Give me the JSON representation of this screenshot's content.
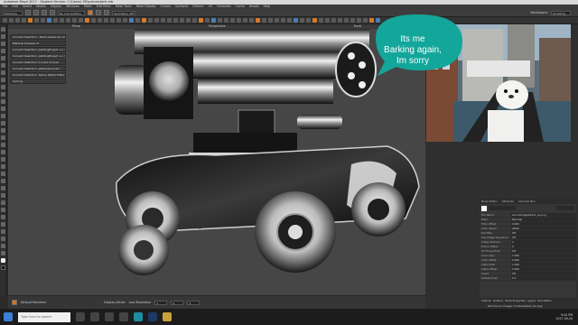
{
  "window": {
    "title": "Autodesk Maya 2017 - Student Version: C:\\Users\\ 3D\\scenes\\tank.mb"
  },
  "menubar": {
    "items": [
      "File",
      "Edit",
      "Select",
      "Modify",
      "Display",
      "Windows",
      "Mesh",
      "Edit Mesh",
      "Mesh Tools",
      "Mesh Display",
      "Curves",
      "Surfaces",
      "Deform",
      "UV",
      "Generate",
      "Cache",
      "Arnold",
      "Help"
    ]
  },
  "toolbar": {
    "mode": "Modeling",
    "live": "No Live Surface",
    "symmetry": "Symmetry: Off",
    "workspace": "Sculpting",
    "labels": [
      "Workspace:",
      "Opacity"
    ]
  },
  "viewport": {
    "header_left": "Persp",
    "header_mid": "Perspective",
    "header_right": "Front"
  },
  "history": {
    "items": [
      "Convert Selection - Mesh (select all edges)",
      "Material Preview: D",
      "Convert Selection -pathingProject +> Orientation: None 1 Mesh",
      "Convert Selection -pathingProject +> Orientation: None",
      "Convert Selection: Curves Convex",
      "Convert Selection: pathingConvert",
      "Convert Selection: Spline (Mesh Editor)",
      "Seli log"
    ]
  },
  "bubble": {
    "line1": "Its me",
    "line2": "Barking again,",
    "line3": "Im sorry"
  },
  "footer": {
    "frame": "Default Renderer",
    "display": "Display Active",
    "resolution": "Low Resolution",
    "items": [
      "1",
      "2",
      "3"
    ]
  },
  "attributes": {
    "tabs": [
      "Node Editor",
      "Attribute",
      "Channel Box"
    ],
    "rows": [
      {
        "k": "File Name",
        "v": "sourceimages/tank_ao.png"
      },
      {
        "k": "Filter",
        "v": "Mipmap"
      },
      {
        "k": "Filter Offset",
        "v": "0.000"
      },
      {
        "k": "Color Space",
        "v": "sRGB"
      },
      {
        "k": "Pre Filter",
        "v": "Off"
      },
      {
        "k": "Use Image Sequence",
        "v": "Off"
      },
      {
        "k": "Image Number",
        "v": "1"
      },
      {
        "k": "Frame Offset",
        "v": "0"
      },
      {
        "k": "UV Tiling Mode",
        "v": "Off"
      },
      {
        "k": "Color Gain",
        "v": "1.000"
      },
      {
        "k": "Color Offset",
        "v": "0.000"
      },
      {
        "k": "Alpha Gain",
        "v": "1.000"
      },
      {
        "k": "Alpha Offset",
        "v": "0.000"
      },
      {
        "k": "Invert",
        "v": "Off"
      },
      {
        "k": "Default Color",
        "v": "0.5"
      }
    ],
    "bottom_tabs": [
      "Shelves",
      "Outliner",
      "Mode Properties",
      "Layers",
      "Orientation"
    ]
  },
  "taskbar": {
    "search_placeholder": "Type here to search",
    "time": "9:42 PM",
    "date": "2017-09-24"
  },
  "help_text": "Dot Cursor Image: C:\\Users\\tank_ao.png"
}
